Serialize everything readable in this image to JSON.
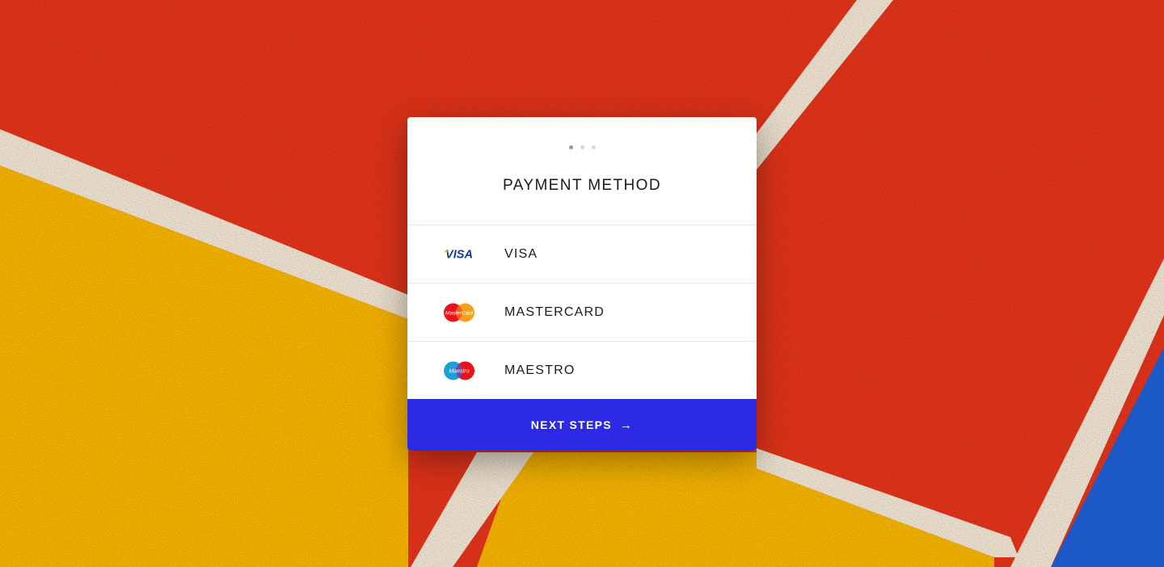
{
  "card": {
    "title": "PAYMENT METHOD",
    "steps": {
      "total": 3,
      "current": 1
    }
  },
  "methods": [
    {
      "label": "VISA",
      "logo_text": "VISA",
      "icon": "visa-logo"
    },
    {
      "label": "MASTERCARD",
      "logo_text": "MasterCard",
      "icon": "mastercard-logo"
    },
    {
      "label": "MAESTRO",
      "logo_text": "Maestro",
      "icon": "maestro-logo"
    }
  ],
  "button": {
    "label": "NEXT STEPS",
    "arrow": "→",
    "color": "#2d2ae6"
  },
  "background": {
    "description_colors": {
      "red": "#e2341a",
      "yellow": "#f6b400",
      "blue": "#1e5fd4",
      "line": "#f0e4d4"
    }
  }
}
